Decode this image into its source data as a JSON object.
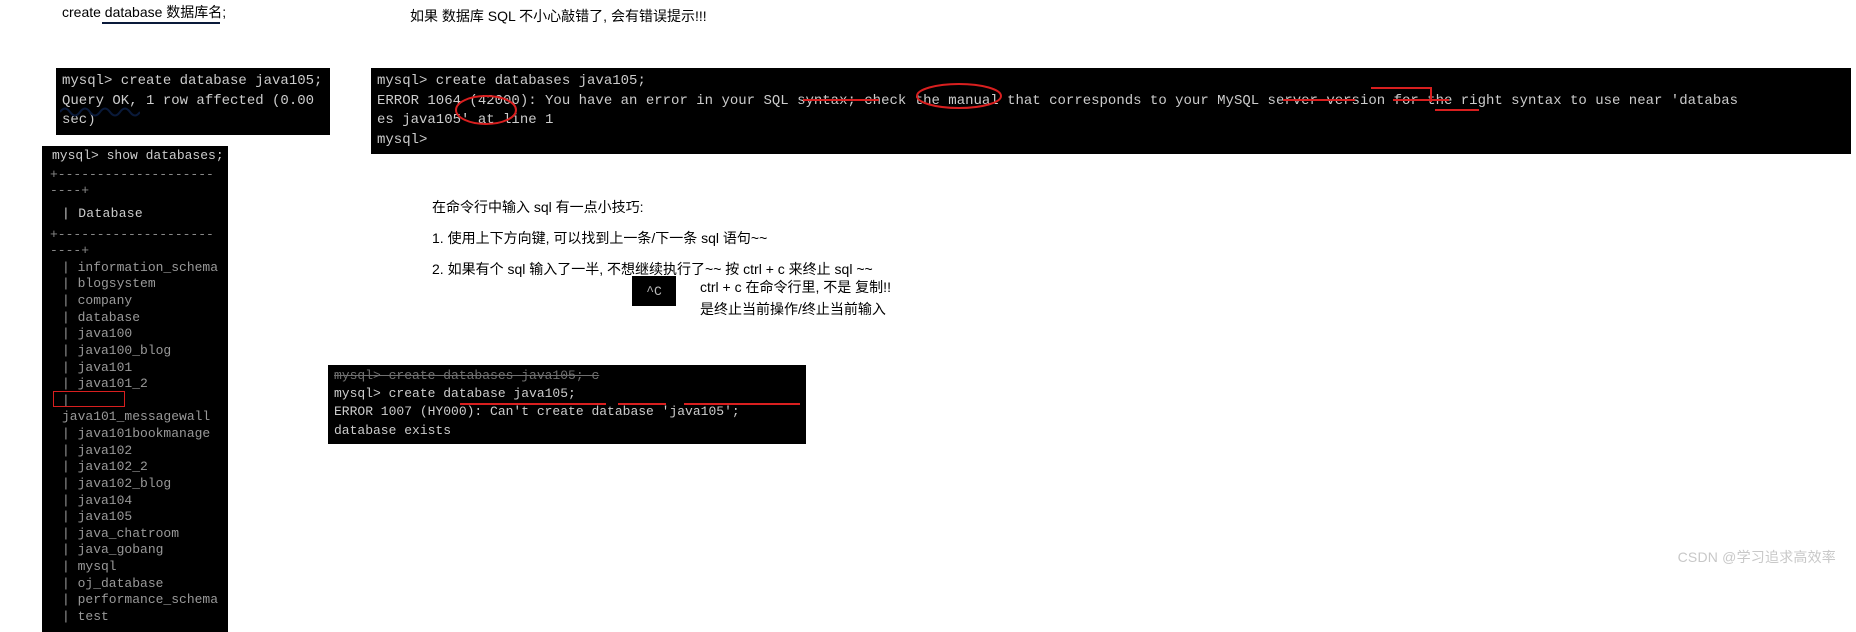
{
  "header": {
    "left": "create database 数据库名;",
    "right": "如果 数据库 SQL 不小心敲错了, 会有错误提示!!!"
  },
  "term1": {
    "line1": "mysql> create database java105;",
    "line2": "Query OK, 1 row affected (0.00 sec)"
  },
  "term2": {
    "cmd": "mysql> show databases;",
    "colhead": "Database",
    "databases": [
      "information_schema",
      "blogsystem",
      "company",
      "database",
      "java100",
      "java100_blog",
      "java101",
      "java101_2",
      "java101_messagewall",
      "java101bookmanage",
      "java102",
      "java102_2",
      "java102_blog",
      "java104",
      "java105",
      "java_chatroom",
      "java_gobang",
      "mysql",
      "oj_database",
      "performance_schema",
      "test"
    ]
  },
  "term3": {
    "line1": "mysql> create databases java105;",
    "line2": "ERROR 1064 (42000): You have an error in your SQL syntax; check the manual that corresponds to your MySQL server version for the right syntax to use near 'databas",
    "line3": "es java105' at line 1",
    "line4": "mysql>"
  },
  "tips": {
    "intro": "在命令行中输入 sql 有一点小技巧:",
    "t1": "1. 使用上下方向键, 可以找到上一条/下一条 sql 语句~~",
    "t2": "2. 如果有个 sql 输入了一半, 不想继续执行了~~ 按 ctrl + c 来终止 sql ~~"
  },
  "ctrlc": {
    "glyph": "^C",
    "line1": "ctrl + c 在命令行里, 不是 复制!!",
    "line2": "是终止当前操作/终止当前输入"
  },
  "term4": {
    "line0": "mysql> create databases java105; c",
    "line1": "mysql> create database java105;",
    "line2": "ERROR 1007 (HY000): Can't create database 'java105'; database exists"
  },
  "watermark": "CSDN @学习追求高效率"
}
